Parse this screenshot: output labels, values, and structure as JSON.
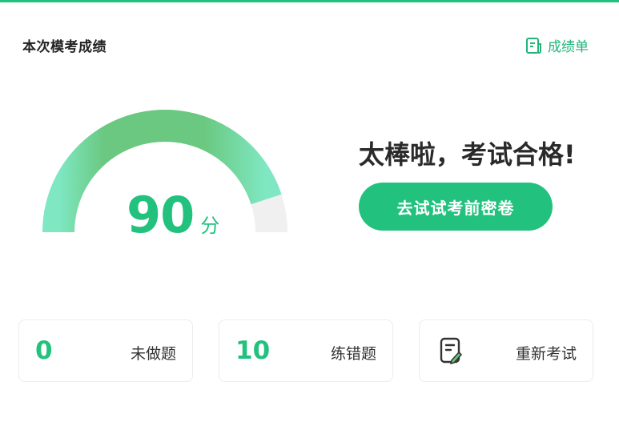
{
  "header": {
    "title": "本次模考成绩",
    "report_label": "成绩单"
  },
  "score": {
    "value": "90",
    "unit": "分",
    "fraction": 0.9
  },
  "result": {
    "headline": "太棒啦，考试合格!",
    "cta_label": "去试试考前密卷"
  },
  "cards": [
    {
      "number": "0",
      "label": "未做题"
    },
    {
      "number": "10",
      "label": "练错题"
    },
    {
      "icon": "retake-exam-icon",
      "label": "重新考试"
    }
  ],
  "colors": {
    "accent": "#22c27e",
    "gauge_light": "#7fe8c3",
    "gauge_mid": "#6ac880",
    "gauge_track": "#f0f0f0"
  }
}
